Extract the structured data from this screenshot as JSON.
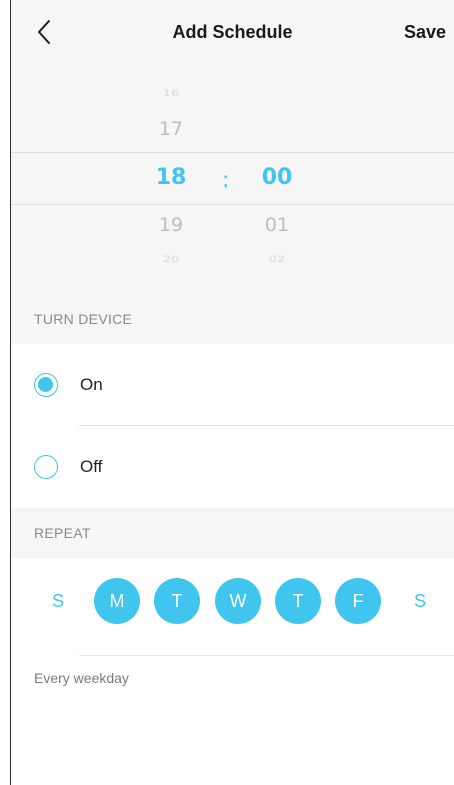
{
  "header": {
    "title": "Add Schedule",
    "save_label": "Save"
  },
  "time_picker": {
    "separator": ":",
    "hours": [
      "16",
      "17",
      "18",
      "19",
      "20"
    ],
    "minutes": [
      "00",
      "01",
      "02"
    ],
    "selected_hour": "18",
    "selected_minute": "00"
  },
  "turn_device": {
    "section_label": "TURN DEVICE",
    "options": [
      {
        "label": "On",
        "selected": true
      },
      {
        "label": "Off",
        "selected": false
      }
    ]
  },
  "repeat": {
    "section_label": "REPEAT",
    "days": [
      {
        "label": "S",
        "active": false
      },
      {
        "label": "M",
        "active": true
      },
      {
        "label": "T",
        "active": true
      },
      {
        "label": "W",
        "active": true
      },
      {
        "label": "T",
        "active": true
      },
      {
        "label": "F",
        "active": true
      },
      {
        "label": "S",
        "active": false
      }
    ],
    "summary": "Every weekday"
  },
  "colors": {
    "accent": "#3fc5ee",
    "section_bg": "#f6f6f6"
  }
}
